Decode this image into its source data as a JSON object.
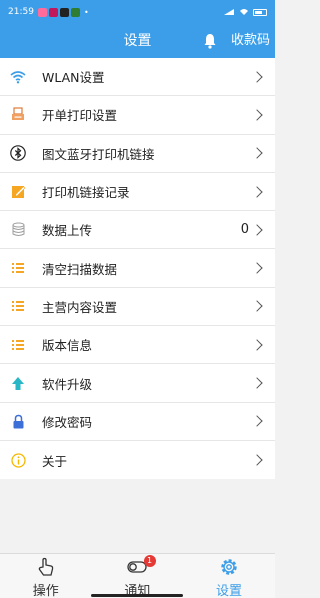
{
  "status_bar": {
    "time": "21:59",
    "dot": "•"
  },
  "header": {
    "title": "设置",
    "action": "收款码"
  },
  "menu": {
    "items": [
      {
        "label": "WLAN设置",
        "icon": "wifi-icon"
      },
      {
        "label": "开单打印设置",
        "icon": "printer-icon"
      },
      {
        "label": "图文蓝牙打印机链接",
        "icon": "bluetooth-icon"
      },
      {
        "label": "打印机链接记录",
        "icon": "edit-icon"
      },
      {
        "label": "数据上传",
        "icon": "database-icon",
        "value": "0"
      },
      {
        "label": "清空扫描数据",
        "icon": "list-icon"
      },
      {
        "label": "主营内容设置",
        "icon": "list-icon"
      },
      {
        "label": "版本信息",
        "icon": "list-icon"
      },
      {
        "label": "软件升级",
        "icon": "upload-arrow-icon"
      },
      {
        "label": "修改密码",
        "icon": "lock-icon"
      },
      {
        "label": "关于",
        "icon": "info-icon"
      }
    ]
  },
  "tabbar": {
    "tabs": [
      {
        "label": "操作",
        "icon": "hand-pointer-icon"
      },
      {
        "label": "通知",
        "icon": "toggle-icon",
        "badge": "1"
      },
      {
        "label": "设置",
        "icon": "gear-icon",
        "active": true
      }
    ]
  },
  "colors": {
    "accent": "#3c9ee8",
    "badge": "#e53935",
    "list_icon": "#f5a623"
  }
}
